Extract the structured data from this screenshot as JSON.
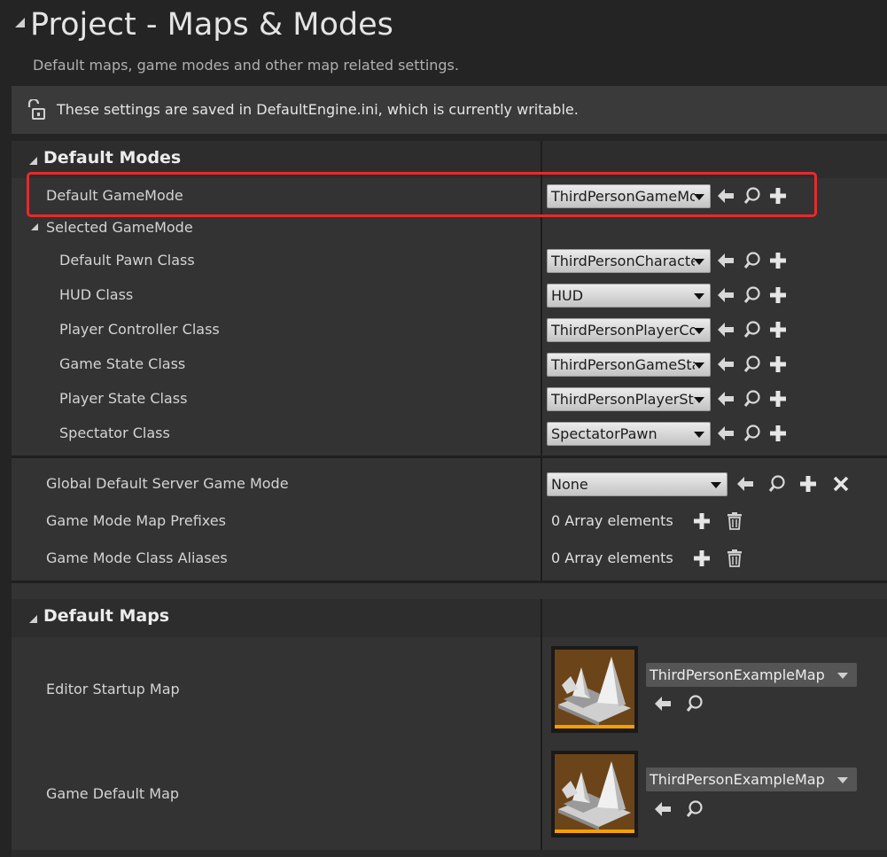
{
  "page": {
    "title": "Project - Maps & Modes",
    "subtitle": "Default maps, game modes and other map related settings.",
    "notice": "These settings are saved in DefaultEngine.ini, which is currently writable."
  },
  "default_modes": {
    "heading": "Default Modes",
    "default_gamemode": {
      "label": "Default GameMode",
      "value": "ThirdPersonGameMode"
    },
    "selected_gamemode": {
      "label": "Selected GameMode",
      "rows": [
        {
          "label": "Default Pawn Class",
          "value": "ThirdPersonCharacter"
        },
        {
          "label": "HUD Class",
          "value": "HUD"
        },
        {
          "label": "Player Controller Class",
          "value": "ThirdPersonPlayerController"
        },
        {
          "label": "Game State Class",
          "value": "ThirdPersonGameState"
        },
        {
          "label": "Player State Class",
          "value": "ThirdPersonPlayerState"
        },
        {
          "label": "Spectator Class",
          "value": "SpectatorPawn"
        }
      ]
    },
    "global_server_mode": {
      "label": "Global Default Server Game Mode",
      "value": "None"
    },
    "map_prefixes": {
      "label": "Game Mode Map Prefixes",
      "value": "0 Array elements"
    },
    "class_aliases": {
      "label": "Game Mode Class Aliases",
      "value": "0 Array elements"
    }
  },
  "default_maps": {
    "heading": "Default Maps",
    "editor_startup": {
      "label": "Editor Startup Map",
      "value": "ThirdPersonExampleMap"
    },
    "game_default": {
      "label": "Game Default Map",
      "value": "ThirdPersonExampleMap"
    }
  },
  "colors": {
    "highlight": "#e8292c",
    "thumbnail_bar": "#f5a000",
    "thumbnail_bg": "#6b4519"
  },
  "icons": [
    "lock-icon",
    "arrow-left-icon",
    "search-icon",
    "plus-icon",
    "close-icon",
    "trash-icon",
    "chevron-down-icon"
  ]
}
